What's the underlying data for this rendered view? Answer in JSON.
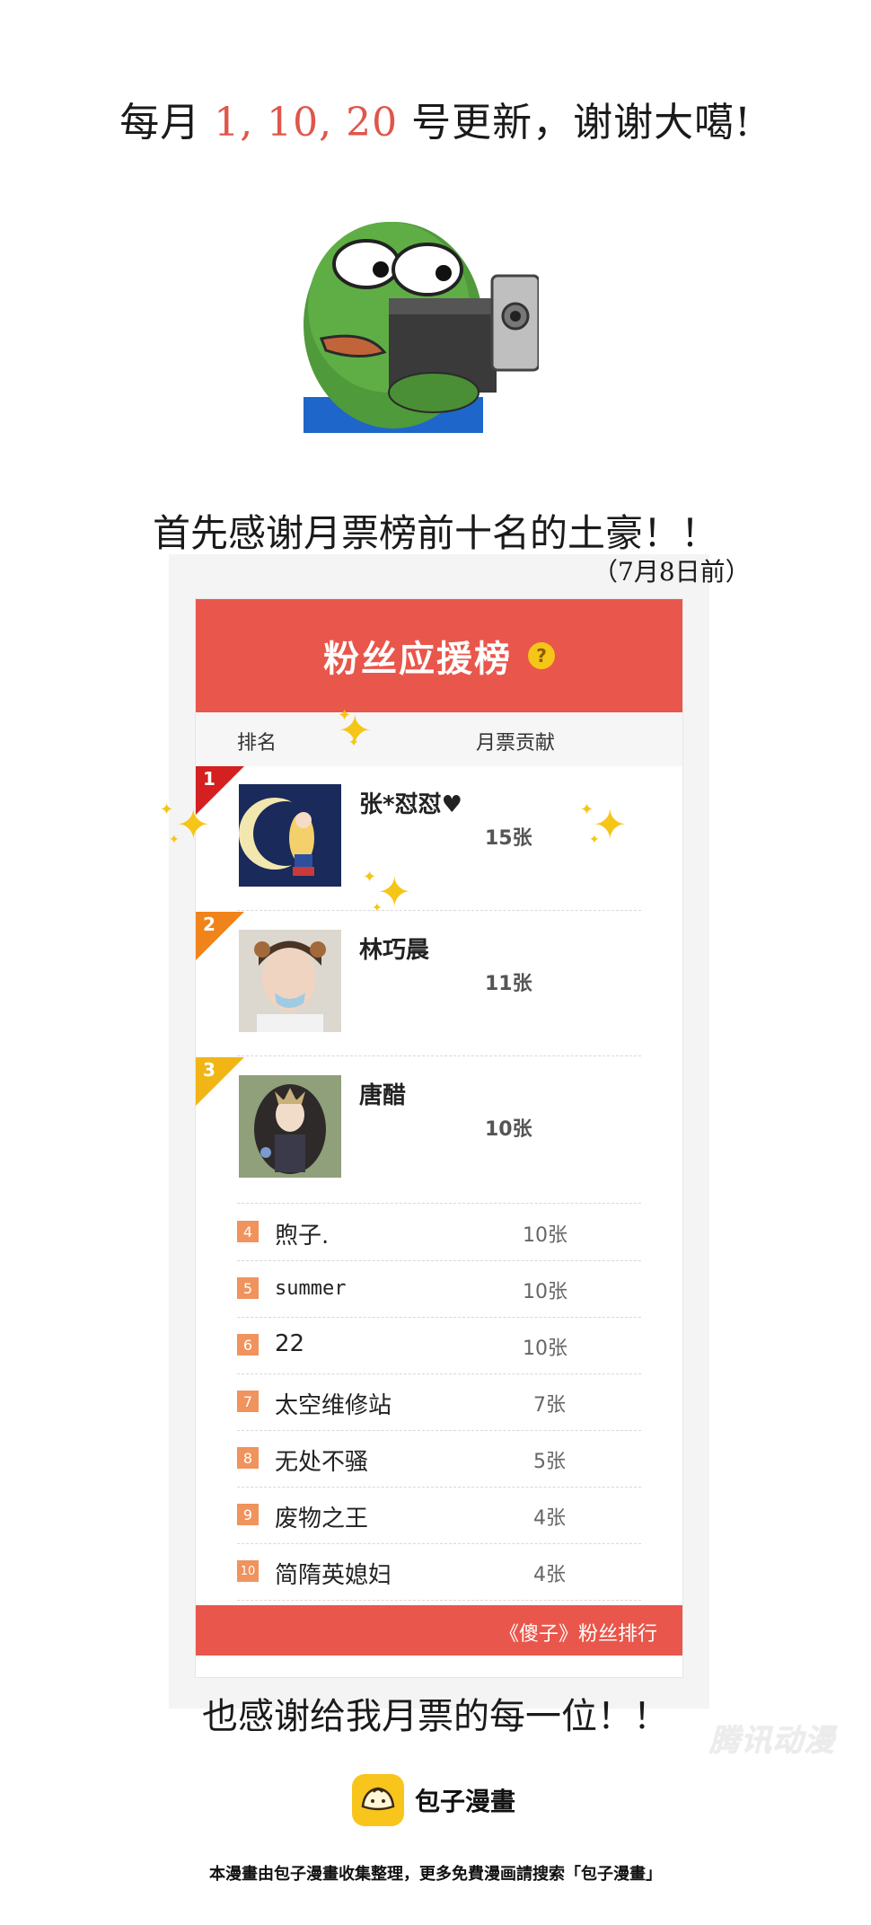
{
  "header": {
    "prefix": "每月 ",
    "dates": "1, 10, 20",
    "suffix": " 号更新，谢谢大噶!"
  },
  "thanks_top": "首先感谢月票榜前十名的土豪！！",
  "date_note": "（7月8日前）",
  "board": {
    "title": "粉丝应援榜",
    "help": "?",
    "col_rank": "排名",
    "col_votes": "月票贡献",
    "top3": [
      {
        "rank": "1",
        "name": "张*怼怼♥",
        "count": "15张",
        "color": "#d42020"
      },
      {
        "rank": "2",
        "name": "林巧晨",
        "count": "11张",
        "color": "#f0841a"
      },
      {
        "rank": "3",
        "name": "唐醋",
        "count": "10张",
        "color": "#f1b516"
      }
    ],
    "list": [
      {
        "rank": "4",
        "name": "煦子.",
        "count": "10张"
      },
      {
        "rank": "5",
        "name": "summer",
        "count": "10张"
      },
      {
        "rank": "6",
        "name": "22",
        "count": "10张"
      },
      {
        "rank": "7",
        "name": "太空维修站",
        "count": "7张"
      },
      {
        "rank": "8",
        "name": "无处不骚",
        "count": "5张"
      },
      {
        "rank": "9",
        "name": "废物之王",
        "count": "4张"
      },
      {
        "rank": "10",
        "name": "简隋英媳妇",
        "count": "4张"
      }
    ],
    "footer": "《傻子》粉丝排行"
  },
  "thanks_bottom": "也感谢给我月票的每一位！！",
  "watermark": "腾讯动漫",
  "brand": {
    "name": "包子漫畫"
  },
  "footer_note": "本漫畫由包子漫畫收集整理，更多免費漫画請搜索「包子漫畫」",
  "colors": {
    "accent": "#e9564b",
    "highlight": "#e0564a",
    "gold": "#f5c518"
  }
}
